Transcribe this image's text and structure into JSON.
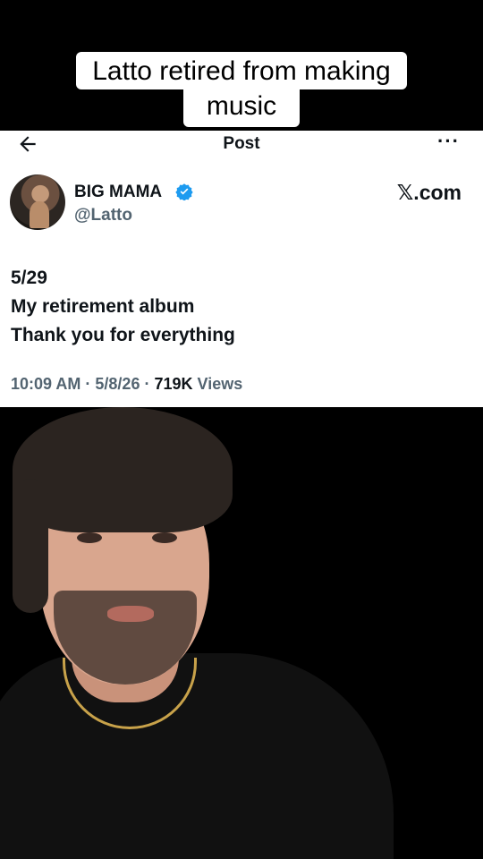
{
  "caption": {
    "line1": "Latto retired from making",
    "line2": "music"
  },
  "tweet": {
    "header_title": "Post",
    "display_name": "BIG MAMA",
    "handle": "@Latto",
    "source": "𝕏.com",
    "text_lines": [
      "5/29",
      "My retirement album",
      "Thank you for everything"
    ],
    "time": "10:09 AM",
    "date": "5/8/26",
    "views_count": "719K",
    "views_label": "Views",
    "separator": "·"
  },
  "colors": {
    "verified": "#1d9bf0",
    "muted_text": "#536471",
    "primary_text": "#0f1419"
  },
  "icons": {
    "back": "back-arrow-icon",
    "more": "more-options-icon",
    "verified": "verified-badge-icon"
  }
}
